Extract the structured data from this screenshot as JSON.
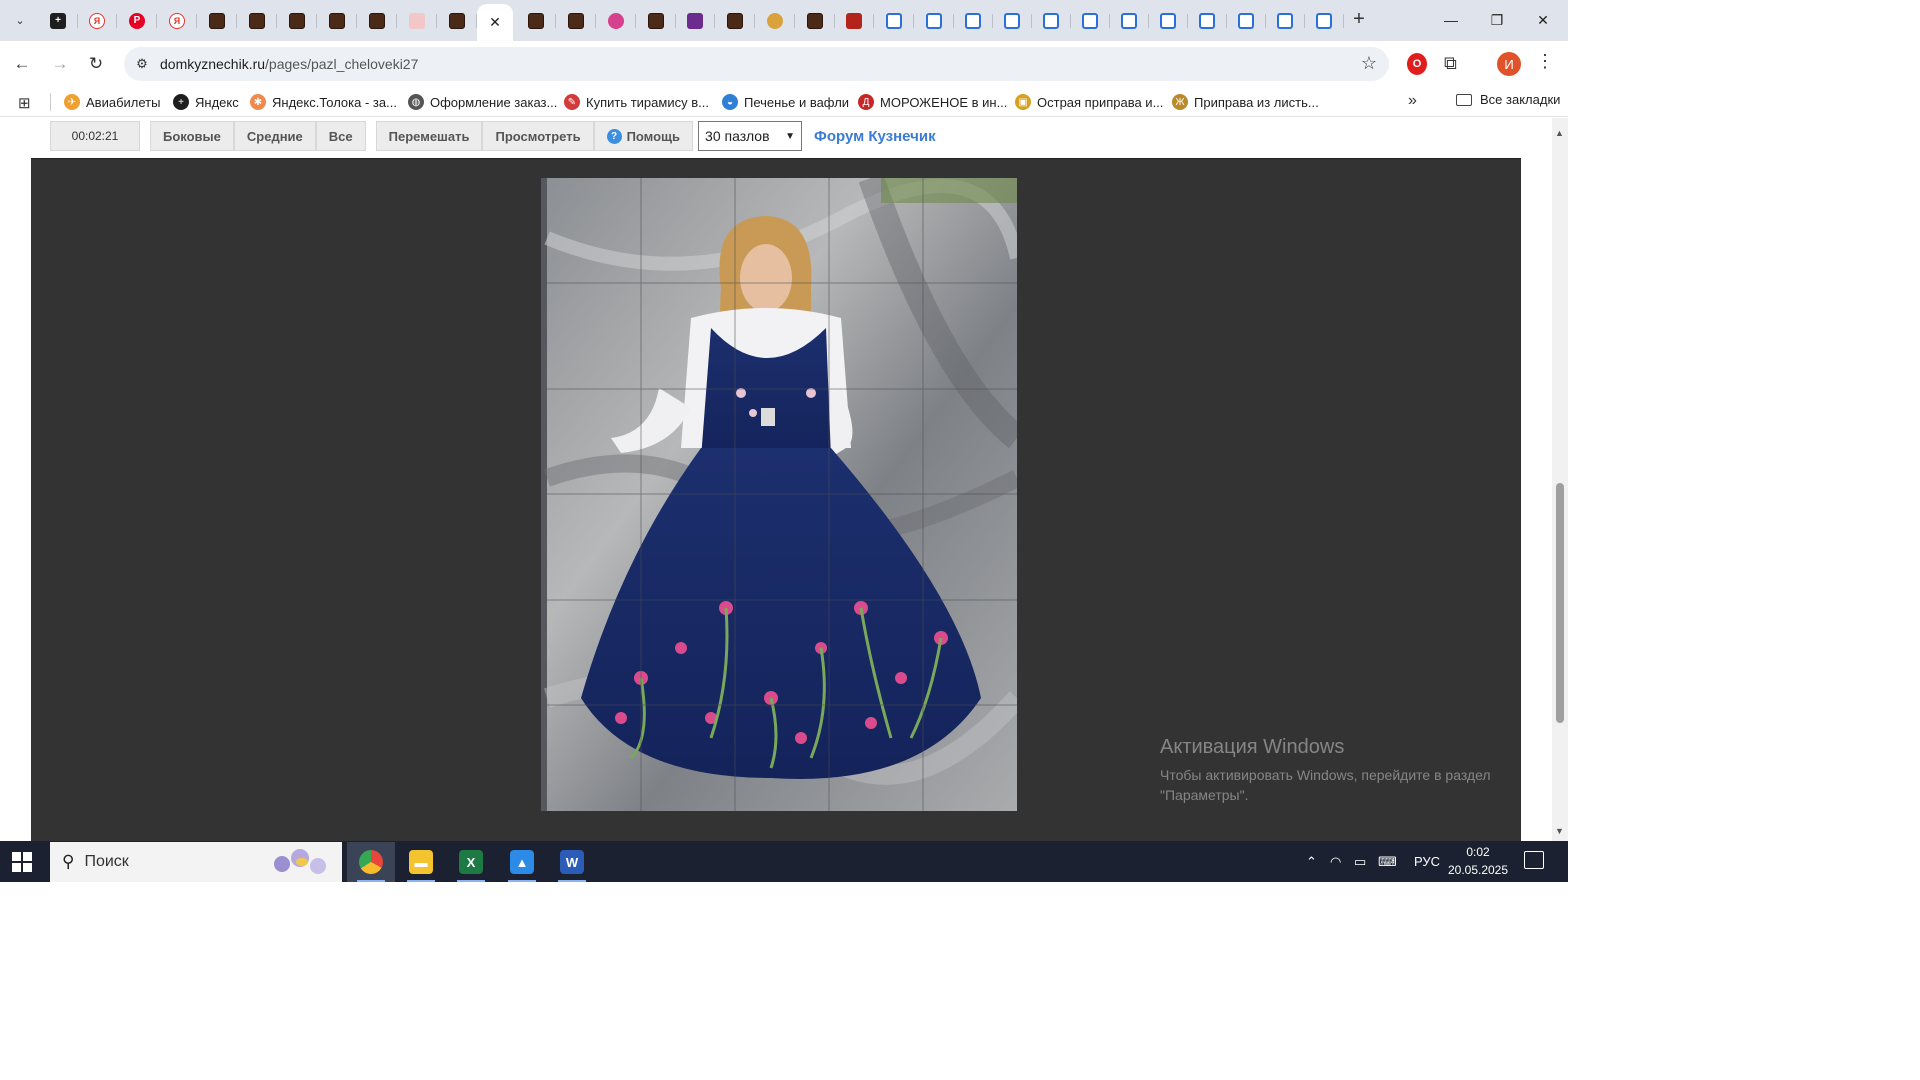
{
  "browser": {
    "tabs": [
      {
        "icon": "tab-list-icon"
      },
      {
        "icon": "dark-puzzle-icon"
      },
      {
        "icon": "yandex-icon",
        "glyph": "Я"
      },
      {
        "icon": "pinterest-icon",
        "glyph": "P"
      },
      {
        "icon": "yandex-icon",
        "glyph": "Я"
      }
    ],
    "active_tab_close": "✕",
    "new_tab": "+",
    "window_controls": {
      "minimize": "—",
      "maximize": "❐",
      "close": "✕"
    }
  },
  "toolbar": {
    "back": "←",
    "forward": "→",
    "reload": "↻",
    "url_host": "domkyznechik.ru",
    "url_path": "/pages/pazl_cheloveki27",
    "star": "☆",
    "profile_initial": "И",
    "menu": "⋮"
  },
  "bookmarks": {
    "items": [
      {
        "label": "Авиабилеты",
        "color": "#f0a030",
        "glyph": "✈"
      },
      {
        "label": "Яндекс",
        "color": "#1e1e1e",
        "glyph": "+"
      },
      {
        "label": "Яндекс.Толока - за...",
        "color": "#f08a4b",
        "glyph": "✱"
      },
      {
        "label": "Оформление заказ...",
        "color": "#555555",
        "glyph": "◍"
      },
      {
        "label": "Купить тирамису в...",
        "color": "#d33a3a",
        "glyph": "✎"
      },
      {
        "label": "Печенье и вафли",
        "color": "#2f7fd6",
        "glyph": "◒"
      },
      {
        "label": "МОРОЖЕНОЕ в ин...",
        "color": "#c62828",
        "glyph": "Д"
      },
      {
        "label": "Острая приправа и...",
        "color": "#d7a020",
        "glyph": "▣"
      },
      {
        "label": "Приправа из листь...",
        "color": "#b88a2a",
        "glyph": "Ж"
      }
    ],
    "more": "»",
    "all_label": "Все закладки"
  },
  "game": {
    "timer": "00:02:21",
    "filter_buttons": [
      "Боковые",
      "Средние",
      "Все"
    ],
    "action_buttons": [
      "Перемешать",
      "Просмотреть"
    ],
    "help_label": "Помощь",
    "help_glyph": "?",
    "pieces_select": "30 пазлов",
    "select_arrow": "▼",
    "forum_link": "Форум Кузнечик",
    "puzzle_grid": {
      "cols": 5,
      "rows": 6
    }
  },
  "watermark": {
    "title": "Активация Windows",
    "subtitle": "Чтобы активировать Windows, перейдите в раздел \"Параметры\"."
  },
  "scrollbar": {
    "up": "▲",
    "down": "▼"
  },
  "taskbar": {
    "search_placeholder": "Поиск",
    "search_glyph": "⚲",
    "apps": [
      {
        "name": "chrome",
        "glyph": "●",
        "color": "#e8453c"
      },
      {
        "name": "file-explorer",
        "glyph": "▬",
        "color": "#f4c430"
      },
      {
        "name": "excel",
        "glyph": "X",
        "color": "#1e7a44"
      },
      {
        "name": "photos",
        "glyph": "▲",
        "color": "#2b8be6"
      },
      {
        "name": "word",
        "glyph": "W",
        "color": "#2b5cb8"
      }
    ],
    "language": "РУС",
    "time": "0:02",
    "date": "20.05.2025"
  }
}
